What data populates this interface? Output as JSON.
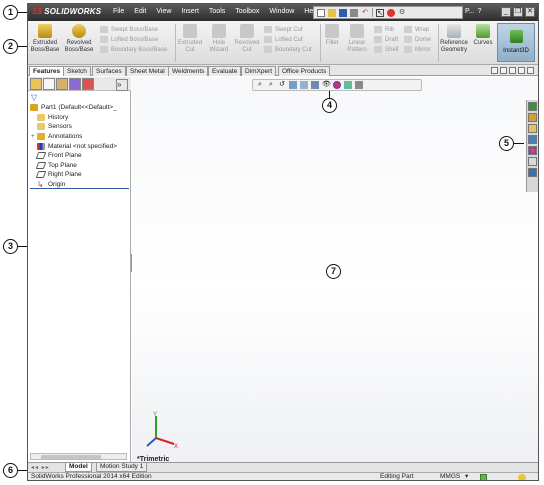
{
  "app": {
    "logo_text": "SOLIDWORKS",
    "menu": [
      "File",
      "Edit",
      "View",
      "Insert",
      "Tools",
      "Toolbox",
      "Window",
      "Help"
    ],
    "search_label": "P...",
    "help_label": "?",
    "window_buttons": [
      "_",
      "❐",
      "✕"
    ]
  },
  "command_manager": {
    "extruded_boss": "Extruded Boss/Base",
    "revolved_boss": "Revolved Boss/Base",
    "swept_boss": "Swept Boss/Base",
    "lofted_boss": "Lofted Boss/Base",
    "boundary_boss": "Boundary Boss/Base",
    "extruded_cut": "Extruded Cut",
    "hole_wizard": "Hole Wizard",
    "revolved_cut": "Revolved Cut",
    "swept_cut": "Swept Cut",
    "lofted_cut": "Lofted Cut",
    "boundary_cut": "Boundary Cut",
    "fillet": "Fillet",
    "linear_pattern": "Linear Pattern",
    "rib": "Rib",
    "draft": "Draft",
    "shell": "Shell",
    "wrap": "Wrap",
    "dome": "Dome",
    "mirror": "Mirror",
    "reference_geometry": "Reference Geometry",
    "curves": "Curves",
    "instant3d": "Instant3D"
  },
  "tabs": [
    "Features",
    "Sketch",
    "Surfaces",
    "Sheet Metal",
    "Weldments",
    "Evaluate",
    "DimXpert",
    "Office Products"
  ],
  "active_tab": "Features",
  "feature_tree": {
    "root": "Part1  (Default<<Default>_",
    "items": [
      "History",
      "Sensors",
      "Annotations",
      "Material <not specified>",
      "Front Plane",
      "Top Plane",
      "Right Plane",
      "Origin"
    ]
  },
  "graphics": {
    "view_label": "*Trimetric"
  },
  "model_tabs": [
    "Model",
    "Motion Study 1"
  ],
  "active_model_tab": "Model",
  "status": {
    "product": "SolidWorks Professional 2014 x64 Edition",
    "mode": "Editing Part",
    "units": "MMGS",
    "units_arrow": "▾"
  },
  "callouts": [
    "1",
    "2",
    "3",
    "4",
    "5",
    "6",
    "7"
  ],
  "colors": {
    "titlebar": "#3a3a3a",
    "instant3d": "#a9c4d8",
    "tree_selected_accent": "#2a5ca8"
  }
}
